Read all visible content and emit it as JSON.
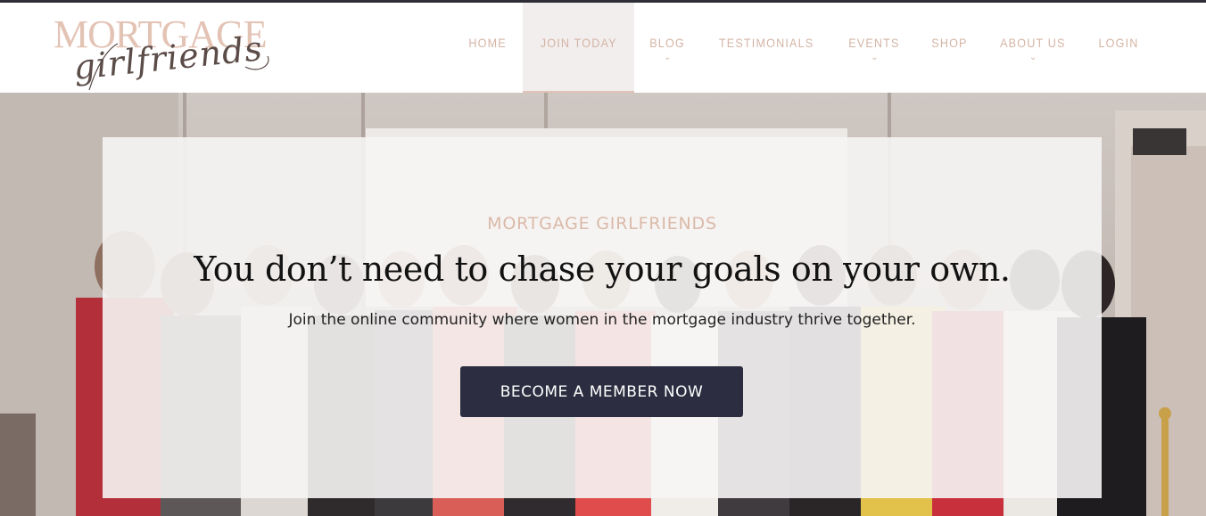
{
  "logo": {
    "word": "MORTGAGE",
    "script": "girlfriends"
  },
  "nav": {
    "items": [
      {
        "label": "HOME",
        "has_dropdown": false
      },
      {
        "label": "JOIN TODAY",
        "has_dropdown": false,
        "active": true
      },
      {
        "label": "BLOG",
        "has_dropdown": true
      },
      {
        "label": "TESTIMONIALS",
        "has_dropdown": false
      },
      {
        "label": "EVENTS",
        "has_dropdown": true
      },
      {
        "label": "SHOP",
        "has_dropdown": false
      },
      {
        "label": "ABOUT US",
        "has_dropdown": true
      },
      {
        "label": "LOGIN",
        "has_dropdown": false
      }
    ],
    "chevron": "⌄"
  },
  "hero": {
    "eyebrow": "MORTGAGE GIRLFRIENDS",
    "headline": "You don’t need to chase your goals on your own.",
    "subline": "Join the online community where women in the mortgage industry thrive together.",
    "cta_label": "BECOME A MEMBER NOW"
  },
  "colors": {
    "accent": "#e3c3b4",
    "nav_text": "#d4b4a5",
    "cta_bg": "#2c2d40",
    "top_line": "#2e2f36"
  },
  "icons": {
    "dropdown": "chevron-down-icon"
  }
}
